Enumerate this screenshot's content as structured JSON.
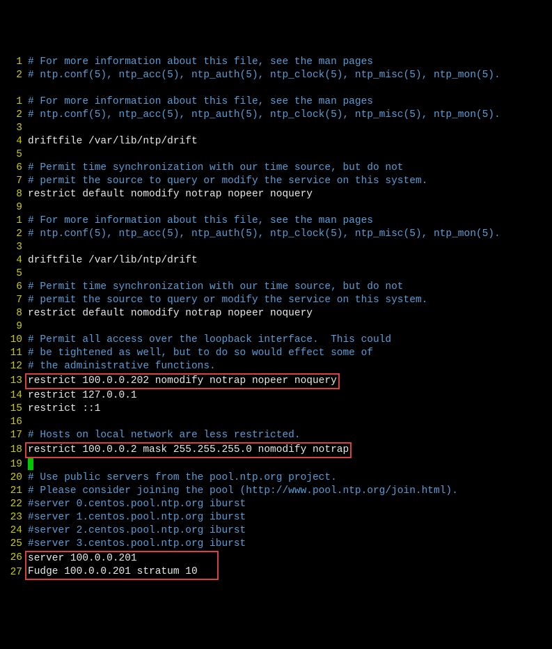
{
  "lines": [
    {
      "n": "1",
      "c": "comment",
      "t": "# For more information about this file, see the man pages"
    },
    {
      "n": "2",
      "c": "comment",
      "t": "# ntp.conf(5), ntp_acc(5), ntp_auth(5), ntp_clock(5), ntp_misc(5), ntp_mon(5)."
    },
    {
      "n": " ",
      "c": "",
      "t": ""
    },
    {
      "n": "1",
      "c": "comment",
      "t": "# For more information about this file, see the man pages"
    },
    {
      "n": "2",
      "c": "comment",
      "t": "# ntp.conf(5), ntp_acc(5), ntp_auth(5), ntp_clock(5), ntp_misc(5), ntp_mon(5)."
    },
    {
      "n": "3",
      "c": "",
      "t": ""
    },
    {
      "n": "4",
      "c": "",
      "t": "driftfile /var/lib/ntp/drift"
    },
    {
      "n": "5",
      "c": "",
      "t": ""
    },
    {
      "n": "6",
      "c": "comment",
      "t": "# Permit time synchronization with our time source, but do not"
    },
    {
      "n": "7",
      "c": "comment",
      "t": "# permit the source to query or modify the service on this system."
    },
    {
      "n": "8",
      "c": "",
      "t": "restrict default nomodify notrap nopeer noquery"
    },
    {
      "n": "9",
      "c": "",
      "t": ""
    },
    {
      "n": "1",
      "c": "comment",
      "t": "# For more information about this file, see the man pages"
    },
    {
      "n": "2",
      "c": "comment",
      "t": "# ntp.conf(5), ntp_acc(5), ntp_auth(5), ntp_clock(5), ntp_misc(5), ntp_mon(5)."
    },
    {
      "n": "3",
      "c": "",
      "t": ""
    },
    {
      "n": "4",
      "c": "",
      "t": "driftfile /var/lib/ntp/drift"
    },
    {
      "n": "5",
      "c": "",
      "t": ""
    },
    {
      "n": "6",
      "c": "comment",
      "t": "# Permit time synchronization with our time source, but do not"
    },
    {
      "n": "7",
      "c": "comment",
      "t": "# permit the source to query or modify the service on this system."
    },
    {
      "n": "8",
      "c": "",
      "t": "restrict default nomodify notrap nopeer noquery"
    },
    {
      "n": "9",
      "c": "",
      "t": ""
    },
    {
      "n": "10",
      "c": "comment",
      "t": "# Permit all access over the loopback interface.  This could"
    },
    {
      "n": "11",
      "c": "comment",
      "t": "# be tightened as well, but to do so would effect some of"
    },
    {
      "n": "12",
      "c": "comment",
      "t": "# the administrative functions."
    },
    {
      "n": "13",
      "c": "",
      "t": "restrict 100.0.0.202 nomodify notrap nopeer noquery",
      "box": true
    },
    {
      "n": "14",
      "c": "",
      "t": "restrict 127.0.0.1"
    },
    {
      "n": "15",
      "c": "",
      "t": "restrict ::1"
    },
    {
      "n": "16",
      "c": "",
      "t": ""
    },
    {
      "n": "17",
      "c": "comment",
      "t": "# Hosts on local network are less restricted."
    },
    {
      "n": "18",
      "c": "",
      "t": "restrict 100.0.0.2 mask 255.255.255.0 nomodify notrap",
      "box": true
    },
    {
      "n": "19",
      "c": "",
      "t": "",
      "cursor": true
    },
    {
      "n": "20",
      "c": "comment",
      "t": "# Use public servers from the pool.ntp.org project."
    },
    {
      "n": "21",
      "c": "comment",
      "t": "# Please consider joining the pool (http://www.pool.ntp.org/join.html)."
    },
    {
      "n": "22",
      "c": "comment",
      "t": "#server 0.centos.pool.ntp.org iburst"
    },
    {
      "n": "23",
      "c": "comment",
      "t": "#server 1.centos.pool.ntp.org iburst"
    },
    {
      "n": "24",
      "c": "comment",
      "t": "#server 2.centos.pool.ntp.org iburst"
    },
    {
      "n": "25",
      "c": "comment",
      "t": "#server 3.centos.pool.ntp.org iburst"
    },
    {
      "n": "26",
      "c": "",
      "t": "server 100.0.0.201",
      "boxStart": true
    },
    {
      "n": "27",
      "c": "",
      "t": "Fudge 100.0.0.201 stratum 10",
      "boxEnd": true
    }
  ]
}
